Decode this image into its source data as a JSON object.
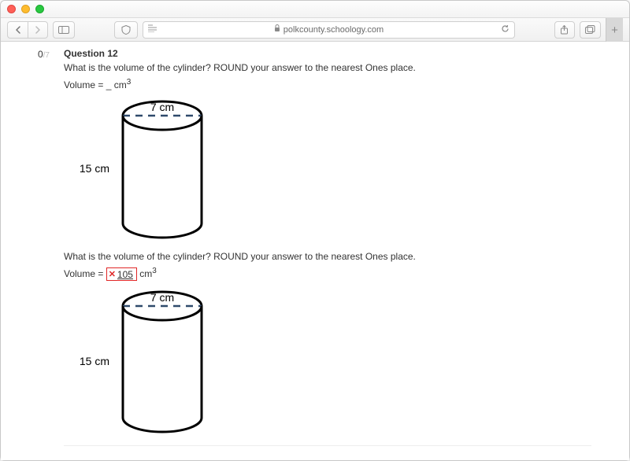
{
  "browser": {
    "url_display": "polkcounty.schoology.com",
    "newtab_plus": "+"
  },
  "question": {
    "score_earned": "0",
    "score_total": "/7",
    "title": "Question 12",
    "prompt": "What is the volume of the cylinder? ROUND your answer to the nearest Ones place.",
    "volume_blank": "Volume = _ cm",
    "cubed": "3",
    "figure": {
      "diameter_label": "7 cm",
      "height_label": "15 cm"
    },
    "prompt2": "What is the volume of the cylinder? ROUND your answer to the nearest Ones place.",
    "volume_label": "Volume = ",
    "answer_wrong": "105",
    "unit_tail": " cm",
    "figure2": {
      "diameter_label": "7 cm",
      "height_label": "15 cm"
    }
  }
}
